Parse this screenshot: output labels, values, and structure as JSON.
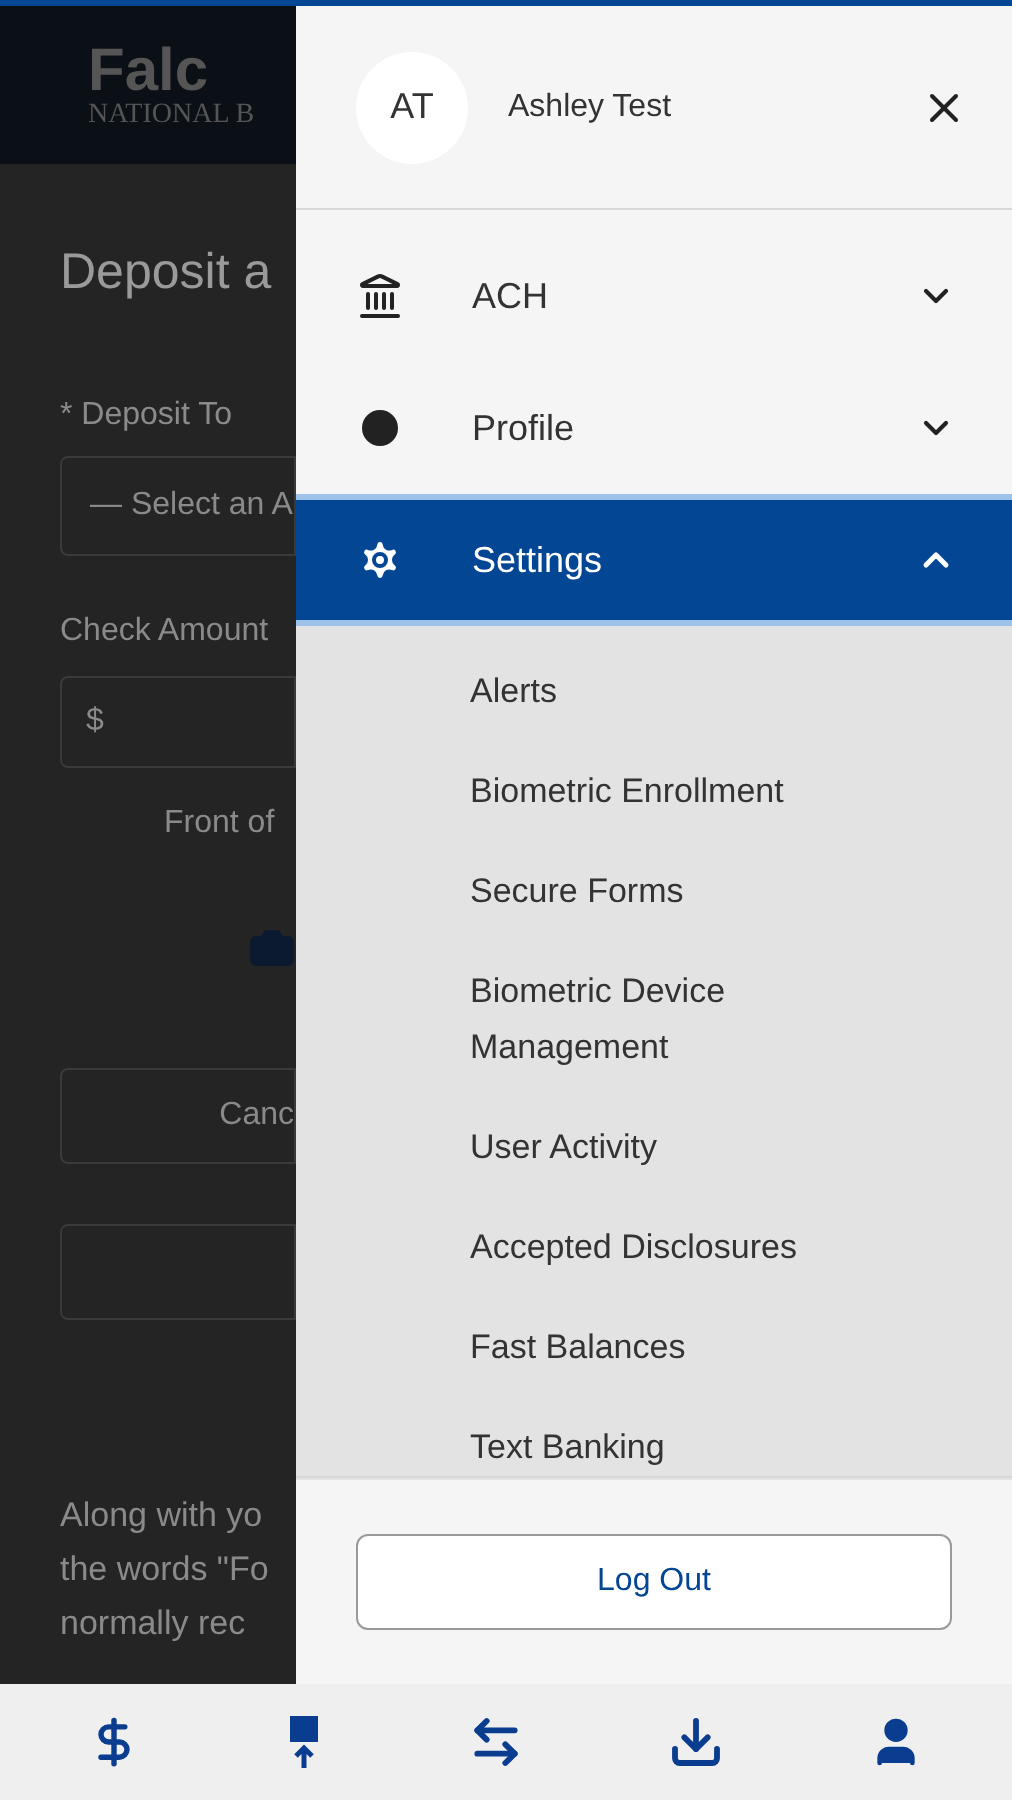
{
  "background_page": {
    "logo_word": "Falc",
    "logo_subtitle": "NATIONAL B",
    "heading": "Deposit a",
    "deposit_to_label": "* Deposit To",
    "account_select": "— Select an A",
    "check_amount_label": "Check Amount",
    "amount_prefix": "$",
    "front_label": "Front of",
    "cancel_button": "Canc",
    "paragraph_lines": [
      "Along with yo",
      "the words \"Fo",
      "normally rec"
    ]
  },
  "drawer": {
    "user": {
      "initials": "AT",
      "name": "Ashley Test"
    },
    "menu": [
      {
        "label": "ACH",
        "expanded": false,
        "selected": false
      },
      {
        "label": "Profile",
        "expanded": false,
        "selected": false
      },
      {
        "label": "Settings",
        "expanded": true,
        "selected": true,
        "children": [
          {
            "label": "Alerts"
          },
          {
            "label": "Biometric Enrollment"
          },
          {
            "label": "Secure Forms"
          },
          {
            "label": "Biometric Device Management"
          },
          {
            "label": "User Activity"
          },
          {
            "label": "Accepted Disclosures"
          },
          {
            "label": "Fast Balances"
          },
          {
            "label": "Text Banking"
          }
        ]
      }
    ],
    "logout_button": "Log Out"
  }
}
